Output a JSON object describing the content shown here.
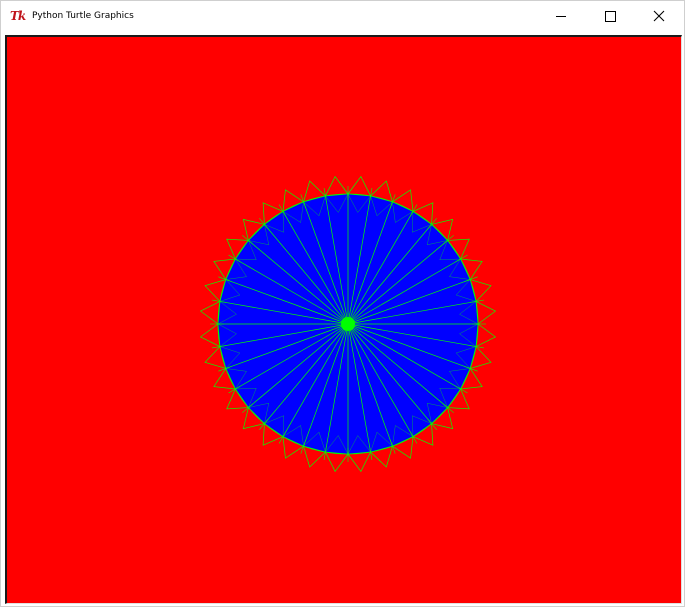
{
  "window": {
    "title": "Python Turtle Graphics",
    "icon_text": "Tk",
    "icon": "tk-feather-icon",
    "controls": {
      "minimize_icon": "minimize-icon",
      "maximize_icon": "maximize-icon",
      "close_icon": "close-icon"
    }
  },
  "canvas": {
    "background_color": "#ff0000",
    "drawing": {
      "circle_fill_color": "#0000ff",
      "line_color": "#00ff00",
      "spoke_count": 36,
      "pattern": "circle with radial spokes and zigzag triangle border"
    }
  }
}
